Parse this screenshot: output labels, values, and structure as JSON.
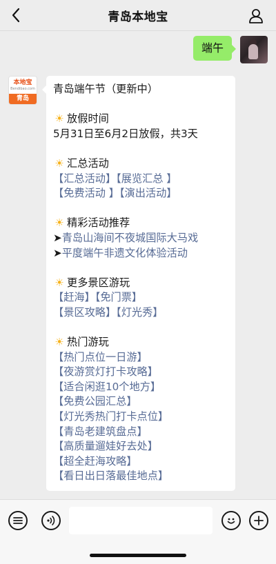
{
  "header": {
    "title": "青岛本地宝",
    "back_icon": "chevron-left-icon",
    "profile_icon": "user-icon"
  },
  "outgoing": {
    "text": "端午"
  },
  "bot_avatar": {
    "logo": "本地宝",
    "site": "Bendibao.com",
    "city": "青岛"
  },
  "message": {
    "title": "青岛端午节（更新中）",
    "holiday": {
      "heading": "放假时间",
      "text": "5月31日至6月2日放假，共3天"
    },
    "summary": {
      "heading": "汇总活动",
      "row1": [
        "【汇总活动】",
        "【展览汇总 】"
      ],
      "row2": [
        "【免费活动 】",
        "【演出活动】"
      ]
    },
    "featured": {
      "heading": "精彩活动推荐",
      "items": [
        "青岛山海间不夜城国际大马戏",
        "平度端午非遗文化体验活动"
      ]
    },
    "scenic": {
      "heading": "更多景区游玩",
      "row1": [
        "【赶海】",
        "【免门票】"
      ],
      "row2": [
        "【景区攻略】",
        "【灯光秀】"
      ]
    },
    "hot": {
      "heading": "热门游玩",
      "items": [
        "【热门点位一日游】",
        "【夜游赏灯打卡攻略】",
        "【适合闲逛10个地方】",
        "【免费公园汇总】",
        "【灯光秀热门打卡点位】",
        "【青岛老建筑盘点】",
        "【高质量遛娃好去处】",
        "【超全赶海攻略】",
        "【看日出日落最佳地点】"
      ]
    },
    "bullet_icon": "sun-icon",
    "arrow_glyph": "➤"
  },
  "input_bar": {
    "menu_icon": "menu-list-icon",
    "voice_icon": "voice-icon",
    "emoji_icon": "emoji-icon",
    "plus_icon": "plus-icon",
    "input_value": ""
  },
  "colors": {
    "link": "#576b95",
    "outgoing_bubble": "#95ec69",
    "background": "#ededed",
    "brand": "#f06b22"
  }
}
